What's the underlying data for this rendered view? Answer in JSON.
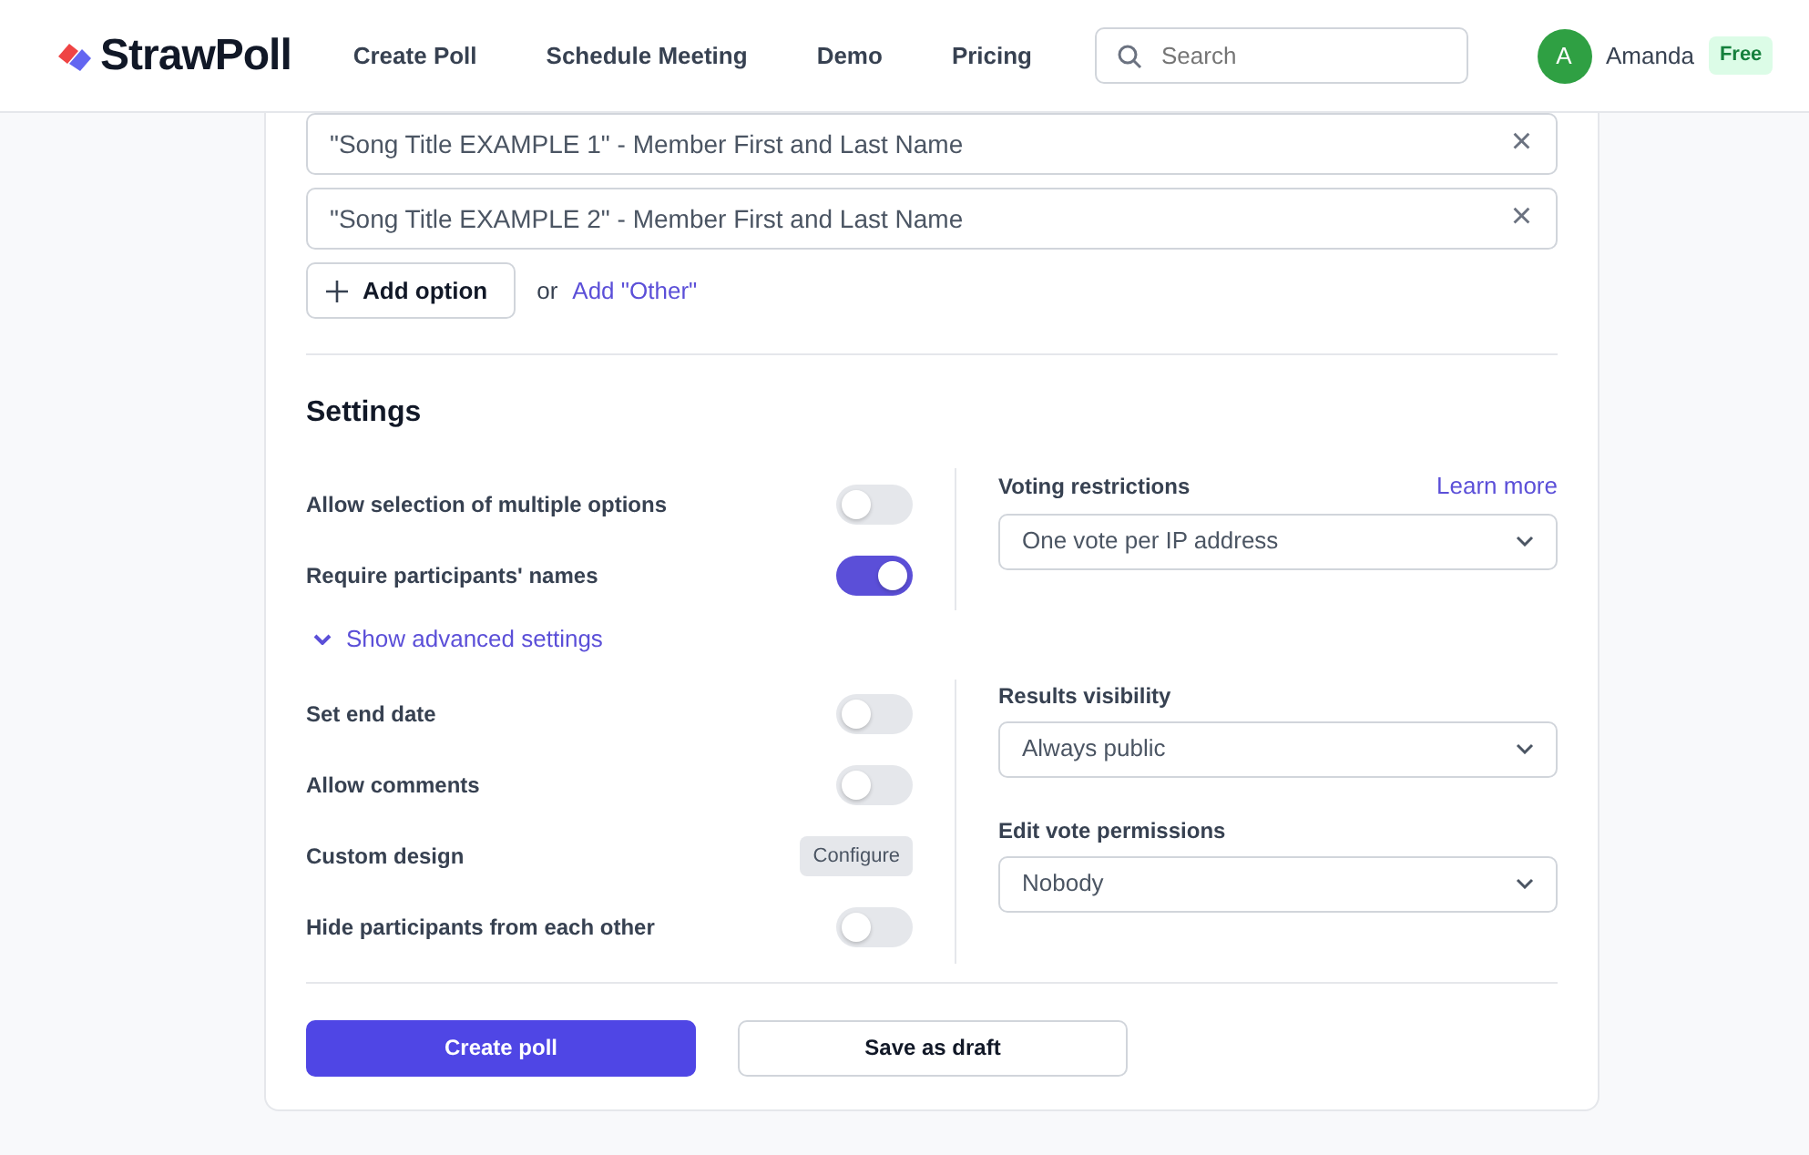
{
  "header": {
    "logo": "StrawPoll",
    "nav": [
      "Create Poll",
      "Schedule Meeting",
      "Demo",
      "Pricing"
    ],
    "search": {
      "placeholder": "Search"
    },
    "user": {
      "initial": "A",
      "name": "Amanda",
      "plan": "Free"
    }
  },
  "options": [
    {
      "value": "\"Song Title EXAMPLE 1\" - Member First and Last Name",
      "remove": "×"
    },
    {
      "value": "\"Song Title EXAMPLE 2\" - Member First and Last Name",
      "remove": "×"
    }
  ],
  "add_option": {
    "button": "Add option",
    "or": "or",
    "other_link": "Add \"Other\""
  },
  "settings": {
    "title": "Settings",
    "basic": [
      {
        "kind": "toggle",
        "label": "Allow selection of multiple options",
        "on": false
      },
      {
        "kind": "toggle",
        "label": "Require participants' names",
        "on": true
      }
    ],
    "basic_selects": [
      {
        "label": "Voting restrictions",
        "link": "Learn more",
        "value": "One vote per IP address"
      }
    ],
    "advanced_toggle": {
      "label": "Show advanced settings",
      "expanded": true
    },
    "advanced": [
      {
        "kind": "toggle",
        "label": "Set end date",
        "on": false
      },
      {
        "kind": "toggle",
        "label": "Allow comments",
        "on": false
      },
      {
        "kind": "button",
        "label": "Custom design",
        "button": "Configure"
      },
      {
        "kind": "toggle",
        "label": "Hide participants from each other",
        "on": false
      }
    ],
    "advanced_selects": [
      {
        "label": "Results visibility",
        "value": "Always public"
      },
      {
        "label": "Edit vote permissions",
        "value": "Nobody"
      }
    ]
  },
  "actions": {
    "primary": "Create poll",
    "secondary": "Save as draft"
  }
}
